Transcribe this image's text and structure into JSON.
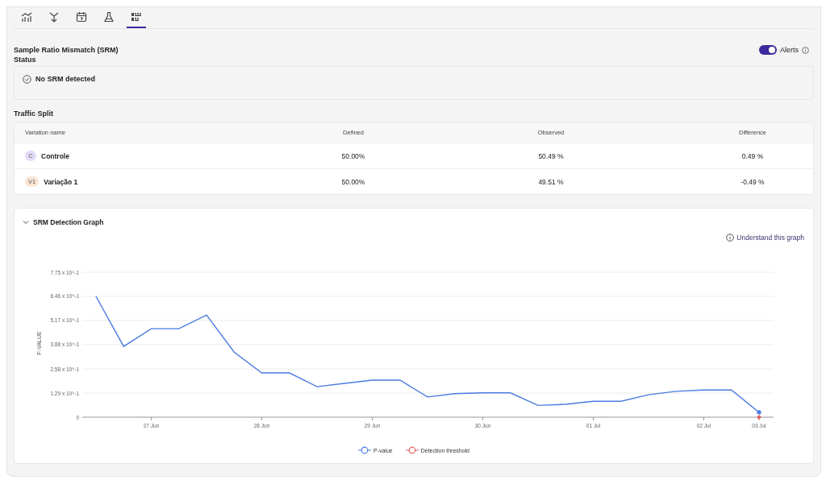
{
  "tabs": [
    {
      "kind": "chart",
      "selected": false
    },
    {
      "kind": "merge",
      "selected": false
    },
    {
      "kind": "calendar",
      "selected": false
    },
    {
      "kind": "flask",
      "selected": false
    },
    {
      "kind": "grid",
      "selected": true
    }
  ],
  "srm_status": {
    "title": "Sample Ratio Mismatch (SRM) Status",
    "alerts": {
      "label": "Alerts",
      "on": true
    },
    "message": "No SRM detected"
  },
  "traffic_split": {
    "title": "Traffic Split",
    "columns": [
      "Variation name",
      "Defined",
      "Observed",
      "Difference"
    ],
    "rows": [
      {
        "badge": "C",
        "color": "#e4dcfa",
        "name": "Controle",
        "defined": "50.00%",
        "observed": "50.49 %",
        "difference": "0.49 %"
      },
      {
        "badge": "V1",
        "color": "#fbe6d4",
        "name": "Variação 1",
        "defined": "50.00%",
        "observed": "49.51 %",
        "difference": "-0.49 %"
      }
    ]
  },
  "graph": {
    "title": "SRM Detection Graph",
    "expanded": true,
    "help_link": "Understand this graph",
    "chart_data": {
      "type": "line",
      "ylabel": "P-VALUE",
      "categories": [
        null,
        null,
        "27 Jun",
        null,
        null,
        null,
        "28 Jun",
        null,
        null,
        null,
        "29 Jun",
        null,
        null,
        null,
        "30 Jun",
        null,
        null,
        null,
        "01 Jul",
        null,
        null,
        null,
        "02 Jul",
        null,
        "03 Jul"
      ],
      "grid": true,
      "series": [
        {
          "name": "P-value",
          "color": "#4a7be0",
          "values": [
            0.646,
            0.378,
            0.473,
            0.473,
            0.546,
            0.348,
            0.237,
            0.237,
            0.163,
            0.181,
            0.198,
            0.198,
            0.108,
            0.126,
            0.13,
            0.13,
            0.063,
            0.069,
            0.085,
            0.085,
            0.12,
            0.138,
            0.145,
            0.145,
            0.026
          ]
        },
        {
          "name": "Detection threshold",
          "color": "#e06060",
          "marker": "diamond",
          "values": [
            null,
            null,
            null,
            null,
            null,
            null,
            null,
            null,
            null,
            null,
            null,
            null,
            null,
            null,
            null,
            null,
            null,
            null,
            null,
            null,
            null,
            null,
            null,
            null,
            0
          ]
        }
      ],
      "ylim": [
        0,
        0.775
      ],
      "yticks": [
        {
          "value": 0,
          "label": "0"
        },
        {
          "value": 0.129,
          "label": "1.29 x 10^-1"
        },
        {
          "value": 0.258,
          "label": "2.58 x 10^-1"
        },
        {
          "value": 0.388,
          "label": "3.88 x 10^-1"
        },
        {
          "value": 0.517,
          "label": "5.17 x 10^-1"
        },
        {
          "value": 0.646,
          "label": "6.46 x 10^-1"
        },
        {
          "value": 0.775,
          "label": "7.75 x 10^-1"
        }
      ]
    }
  }
}
